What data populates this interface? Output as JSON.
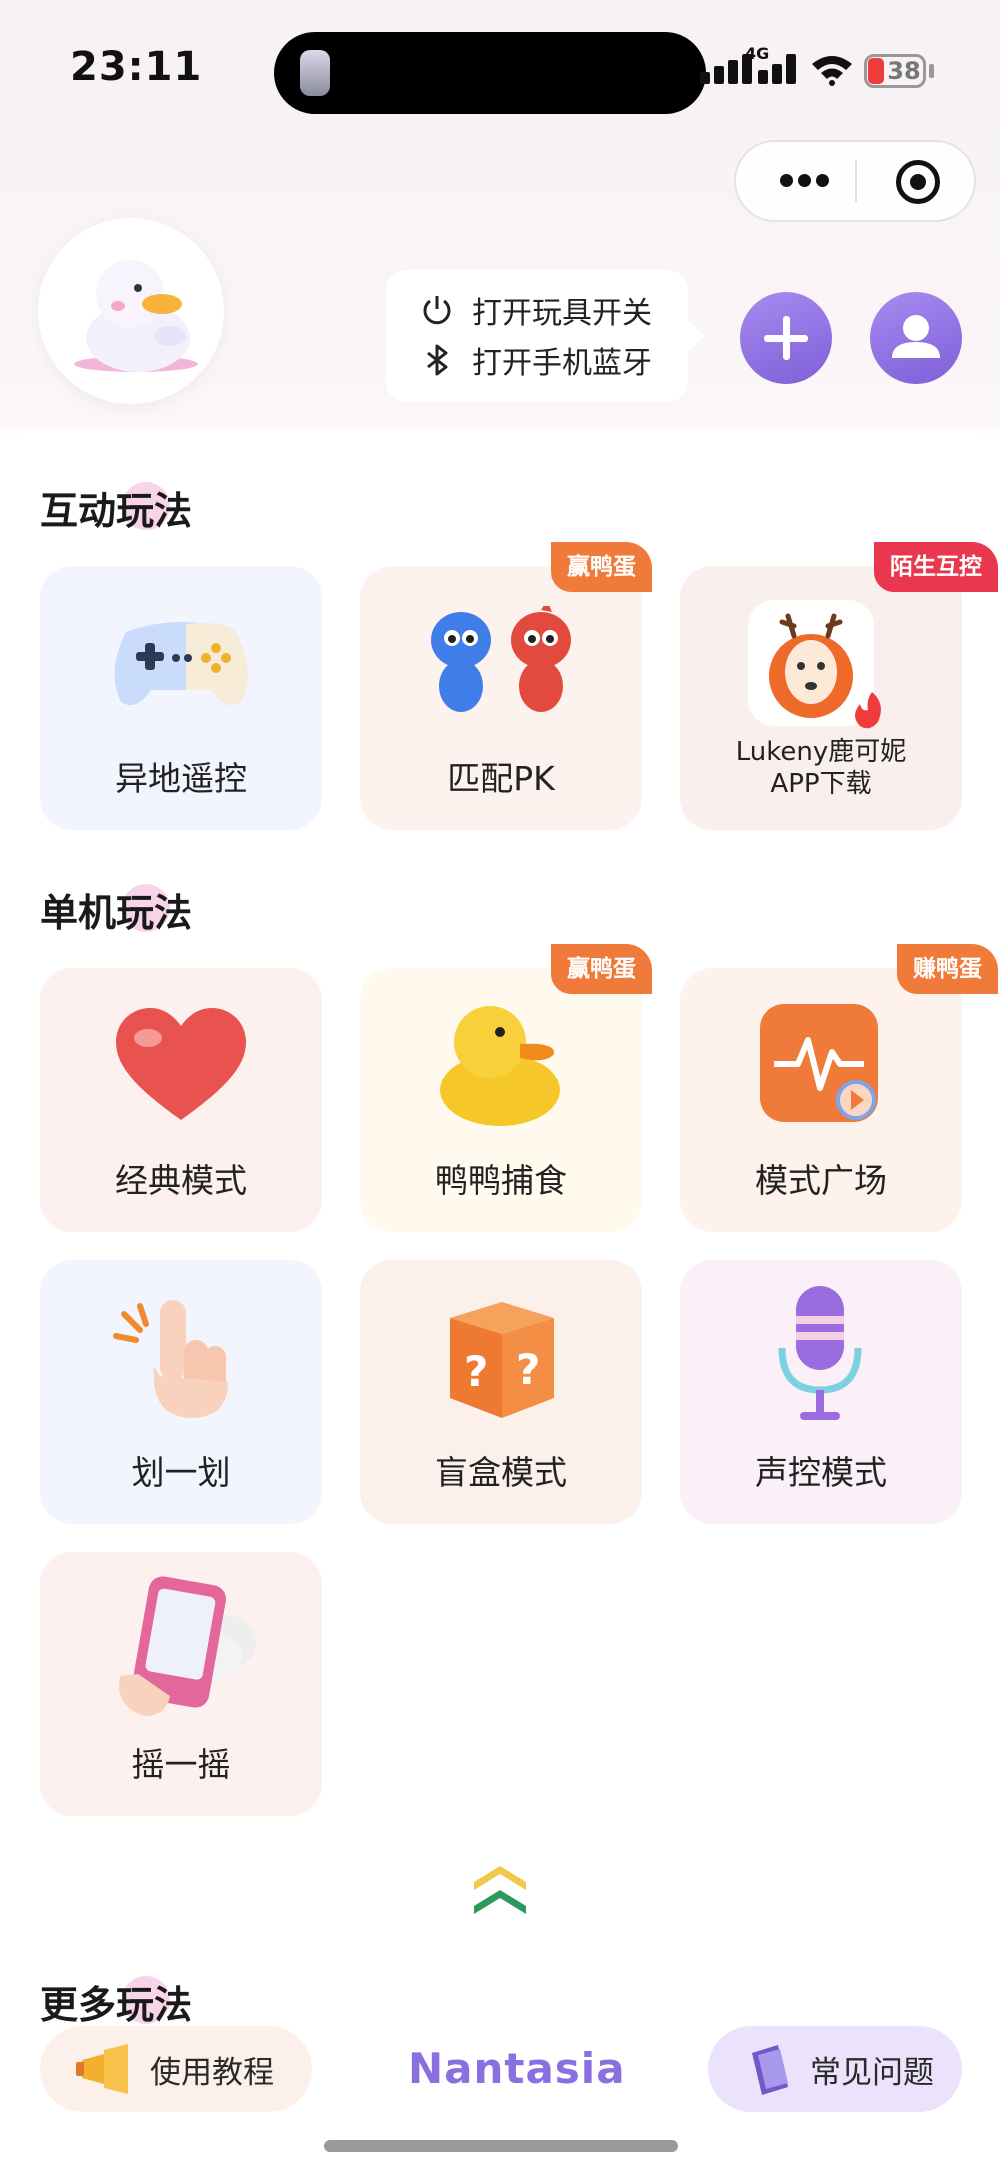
{
  "status_bar": {
    "time": "23:11",
    "network": "4G",
    "battery": "38"
  },
  "tips": {
    "toy_switch": "打开玩具开关",
    "bluetooth": "打开手机蓝牙"
  },
  "sections": {
    "interactive": {
      "title": "互动玩法",
      "cards": [
        {
          "label": "异地遥控",
          "icon": "gamepad-icon"
        },
        {
          "label": "匹配PK",
          "badge": "赢鸭蛋",
          "icon": "pk-mascots-icon"
        },
        {
          "label": "Lukeny鹿可妮\nAPP下载",
          "label_line1": "Lukeny鹿可妮",
          "label_line2": "APP下载",
          "badge": "陌生互控",
          "icon": "deer-app-icon"
        }
      ]
    },
    "single": {
      "title": "单机玩法",
      "cards": [
        {
          "label": "经典模式",
          "icon": "heart-icon"
        },
        {
          "label": "鸭鸭捕食",
          "badge": "赢鸭蛋",
          "icon": "rubber-duck-icon"
        },
        {
          "label": "模式广场",
          "badge": "赚鸭蛋",
          "icon": "waveform-play-icon"
        },
        {
          "label": "划一划",
          "icon": "finger-swipe-icon"
        },
        {
          "label": "盲盒模式",
          "icon": "mystery-box-icon"
        },
        {
          "label": "声控模式",
          "icon": "microphone-icon"
        },
        {
          "label": "摇一摇",
          "icon": "shake-phone-icon"
        }
      ]
    },
    "more": {
      "title": "更多玩法"
    }
  },
  "bottom": {
    "tutorial": "使用教程",
    "brand": "Nantasia",
    "faq": "常见问题"
  },
  "colors": {
    "accent_purple": "#8a6fe0",
    "badge_orange": "#f07a3a",
    "badge_red": "#e8374f"
  }
}
